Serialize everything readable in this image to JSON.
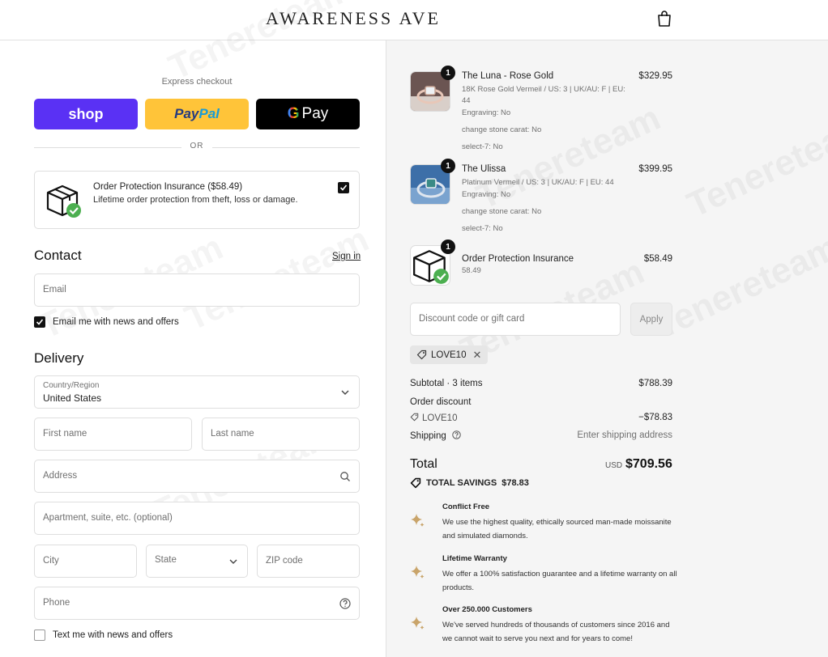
{
  "header": {
    "brand": "AWARENESS AVE"
  },
  "express": {
    "label": "Express checkout",
    "shop": "shop",
    "paypal_a": "Pay",
    "paypal_b": "Pal",
    "gpay_g": "G",
    "gpay": "Pay",
    "or": "OR"
  },
  "insurance": {
    "title": "Order Protection Insurance ($58.49)",
    "subtitle": "Lifetime order protection from theft, loss or damage.",
    "checked": true
  },
  "contact": {
    "title": "Contact",
    "sign_in": "Sign in",
    "email_placeholder": "Email",
    "news_label": "Email me with news and offers"
  },
  "delivery": {
    "title": "Delivery",
    "country_label": "Country/Region",
    "country_value": "United States",
    "first_name": "First name",
    "last_name": "Last name",
    "address": "Address",
    "apartment": "Apartment, suite, etc. (optional)",
    "city": "City",
    "state": "State",
    "zip": "ZIP code",
    "phone": "Phone",
    "text_label": "Text me with news and offers"
  },
  "items": [
    {
      "qty": "1",
      "name": "The Luna - Rose Gold",
      "price": "$329.95",
      "meta": [
        "18K Rose Gold Vermeil / US: 3 | UK/AU: F | EU: 44",
        "Engraving: No",
        "change stone carat: No",
        "select-7: No"
      ]
    },
    {
      "qty": "1",
      "name": "The Ulissa",
      "price": "$399.95",
      "meta": [
        "Platinum Vermeil / US: 3 | UK/AU: F | EU: 44",
        "Engraving: No",
        "change stone carat: No",
        "select-7: No"
      ]
    },
    {
      "qty": "1",
      "name": "Order Protection Insurance",
      "price": "$58.49",
      "meta": [
        "58.49"
      ]
    }
  ],
  "discount": {
    "placeholder": "Discount code or gift card",
    "apply": "Apply",
    "code": "LOVE10"
  },
  "summary": {
    "subtotal_label": "Subtotal · 3 items",
    "subtotal_value": "$788.39",
    "order_discount": "Order discount",
    "discount_code": "LOVE10",
    "discount_value": "−$78.83",
    "shipping_label": "Shipping",
    "shipping_value": "Enter shipping address",
    "total_label": "Total",
    "currency": "USD",
    "total_value": "$709.56",
    "savings_label": "TOTAL SAVINGS",
    "savings_value": "$78.83"
  },
  "features": [
    {
      "title": "Conflict Free",
      "desc": "We use the highest quality, ethically sourced man-made moissanite and simulated diamonds."
    },
    {
      "title": "Lifetime Warranty",
      "desc": "We offer a 100% satisfaction guarantee and a lifetime warranty on all products."
    },
    {
      "title": "Over 250.000 Customers",
      "desc": "We've served hundreds of thousands of customers since 2016 and we cannot wait to serve you next and for years to come!"
    }
  ],
  "watermark": "Tenereteam",
  "colors": {
    "shop": "#5a31f4",
    "paypal": "#ffc439",
    "gpay": "#000000",
    "check": "#111111"
  }
}
